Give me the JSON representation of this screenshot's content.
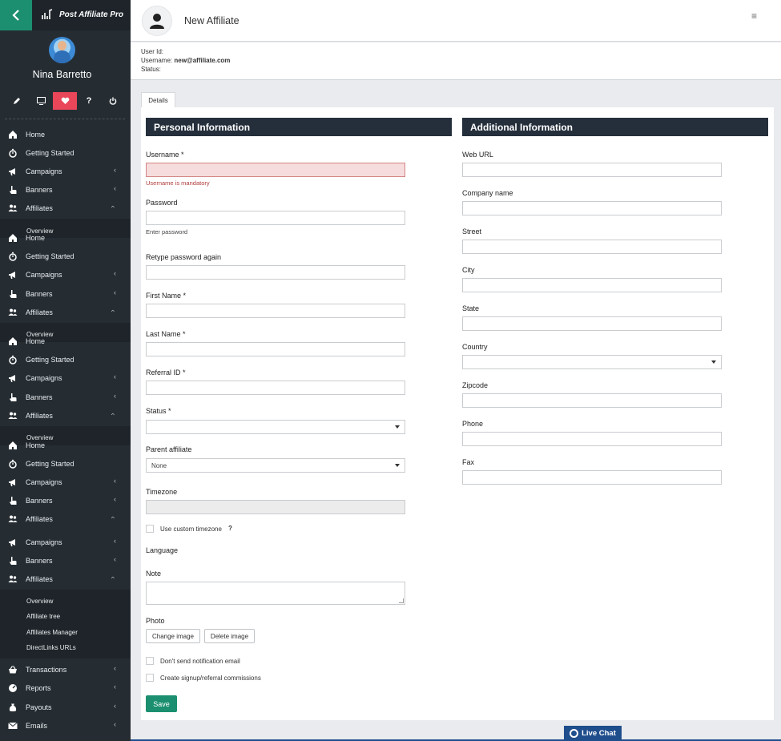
{
  "sidebar": {
    "brand": "Post Affiliate Pro",
    "user_name": "Nina Barretto",
    "icons": [
      "pencil-icon",
      "monitor-icon",
      "heart-icon",
      "question-icon",
      "power-icon"
    ],
    "question_glyph": "?",
    "group1": [
      {
        "label": "Home",
        "icon": "home-icon"
      },
      {
        "label": "Getting Started",
        "icon": "stopwatch-icon"
      },
      {
        "label": "Campaigns",
        "icon": "megaphone-icon",
        "chevron": true
      },
      {
        "label": "Banners",
        "icon": "hand-pointer-icon",
        "chevron": true
      },
      {
        "label": "Affiliates",
        "icon": "users-icon",
        "chevron": true,
        "open": true
      }
    ],
    "group1_sub": [
      "Overview"
    ],
    "group2": [
      {
        "label": "Home",
        "icon": "home-icon"
      },
      {
        "label": "Getting Started",
        "icon": "stopwatch-icon"
      },
      {
        "label": "Campaigns",
        "icon": "megaphone-icon",
        "chevron": true
      },
      {
        "label": "Banners",
        "icon": "hand-pointer-icon",
        "chevron": true
      },
      {
        "label": "Affiliates",
        "icon": "users-icon",
        "chevron": true,
        "open": true
      }
    ],
    "group2_sub": [
      "Overview"
    ],
    "group3": [
      {
        "label": "Home",
        "icon": "home-icon"
      },
      {
        "label": "Getting Started",
        "icon": "stopwatch-icon"
      },
      {
        "label": "Campaigns",
        "icon": "megaphone-icon",
        "chevron": true
      },
      {
        "label": "Banners",
        "icon": "hand-pointer-icon",
        "chevron": true
      },
      {
        "label": "Affiliates",
        "icon": "users-icon",
        "chevron": true,
        "open": true
      }
    ],
    "group3_sub": [
      "Overview"
    ],
    "group4": [
      {
        "label": "Home",
        "icon": "home-icon"
      },
      {
        "label": "Getting Started",
        "icon": "stopwatch-icon"
      },
      {
        "label": "Campaigns",
        "icon": "megaphone-icon",
        "chevron": true
      },
      {
        "label": "Banners",
        "icon": "hand-pointer-icon",
        "chevron": true
      },
      {
        "label": "Affiliates",
        "icon": "users-icon",
        "chevron": true,
        "open": true
      }
    ],
    "group5": [
      {
        "label": "Campaigns",
        "icon": "megaphone-icon",
        "chevron": true
      },
      {
        "label": "Banners",
        "icon": "hand-pointer-icon",
        "chevron": true
      },
      {
        "label": "Affiliates",
        "icon": "users-icon",
        "chevron": true,
        "open": true
      }
    ],
    "group5_sub": [
      "Overview",
      "Affiliate tree",
      "Affiliates Manager",
      "DirectLinks URLs"
    ],
    "bottom_items": [
      {
        "label": "Transactions",
        "icon": "basket-icon",
        "chevron": true
      },
      {
        "label": "Reports",
        "icon": "dashboard-icon",
        "chevron": true
      },
      {
        "label": "Payouts",
        "icon": "moneybag-icon",
        "chevron": true
      },
      {
        "label": "Emails",
        "icon": "envelope-icon",
        "chevron": true
      }
    ]
  },
  "header": {
    "title": "New Affiliate",
    "menu_glyph": "≡"
  },
  "info": {
    "user_id_label": "User Id:",
    "username_label": "Username:",
    "username_value": "new@affiliate.com",
    "status_label": "Status:"
  },
  "tab": {
    "label": "Details"
  },
  "personal": {
    "title": "Personal Information",
    "username_label": "Username *",
    "username_error": "Username is mandatory",
    "password_label": "Password",
    "password_help": "Enter password",
    "retype_label": "Retype password again",
    "first_name_label": "First Name *",
    "last_name_label": "Last Name *",
    "referral_label": "Referral ID *",
    "status_label": "Status *",
    "parent_label": "Parent affiliate",
    "parent_value": "None",
    "timezone_label": "Timezone",
    "custom_tz_label": "Use custom timezone",
    "custom_tz_help_glyph": "?",
    "language_label": "Language",
    "note_label": "Note",
    "photo_label": "Photo",
    "change_image": "Change image",
    "delete_image": "Delete image",
    "no_notify_label": "Don't send notification email",
    "create_commissions_label": "Create signup/referral commissions",
    "save": "Save"
  },
  "additional": {
    "title": "Additional Information",
    "web_url_label": "Web URL",
    "company_label": "Company name",
    "street_label": "Street",
    "city_label": "City",
    "state_label": "State",
    "country_label": "Country",
    "zipcode_label": "Zipcode",
    "phone_label": "Phone",
    "fax_label": "Fax"
  },
  "live_chat": {
    "label": "Live Chat"
  },
  "colors": {
    "accent": "#1b8f6f",
    "sidebar_bg": "#252d33",
    "section_header": "#252f3c",
    "active_icon": "#e9465a",
    "chat": "#1f4e8c"
  }
}
